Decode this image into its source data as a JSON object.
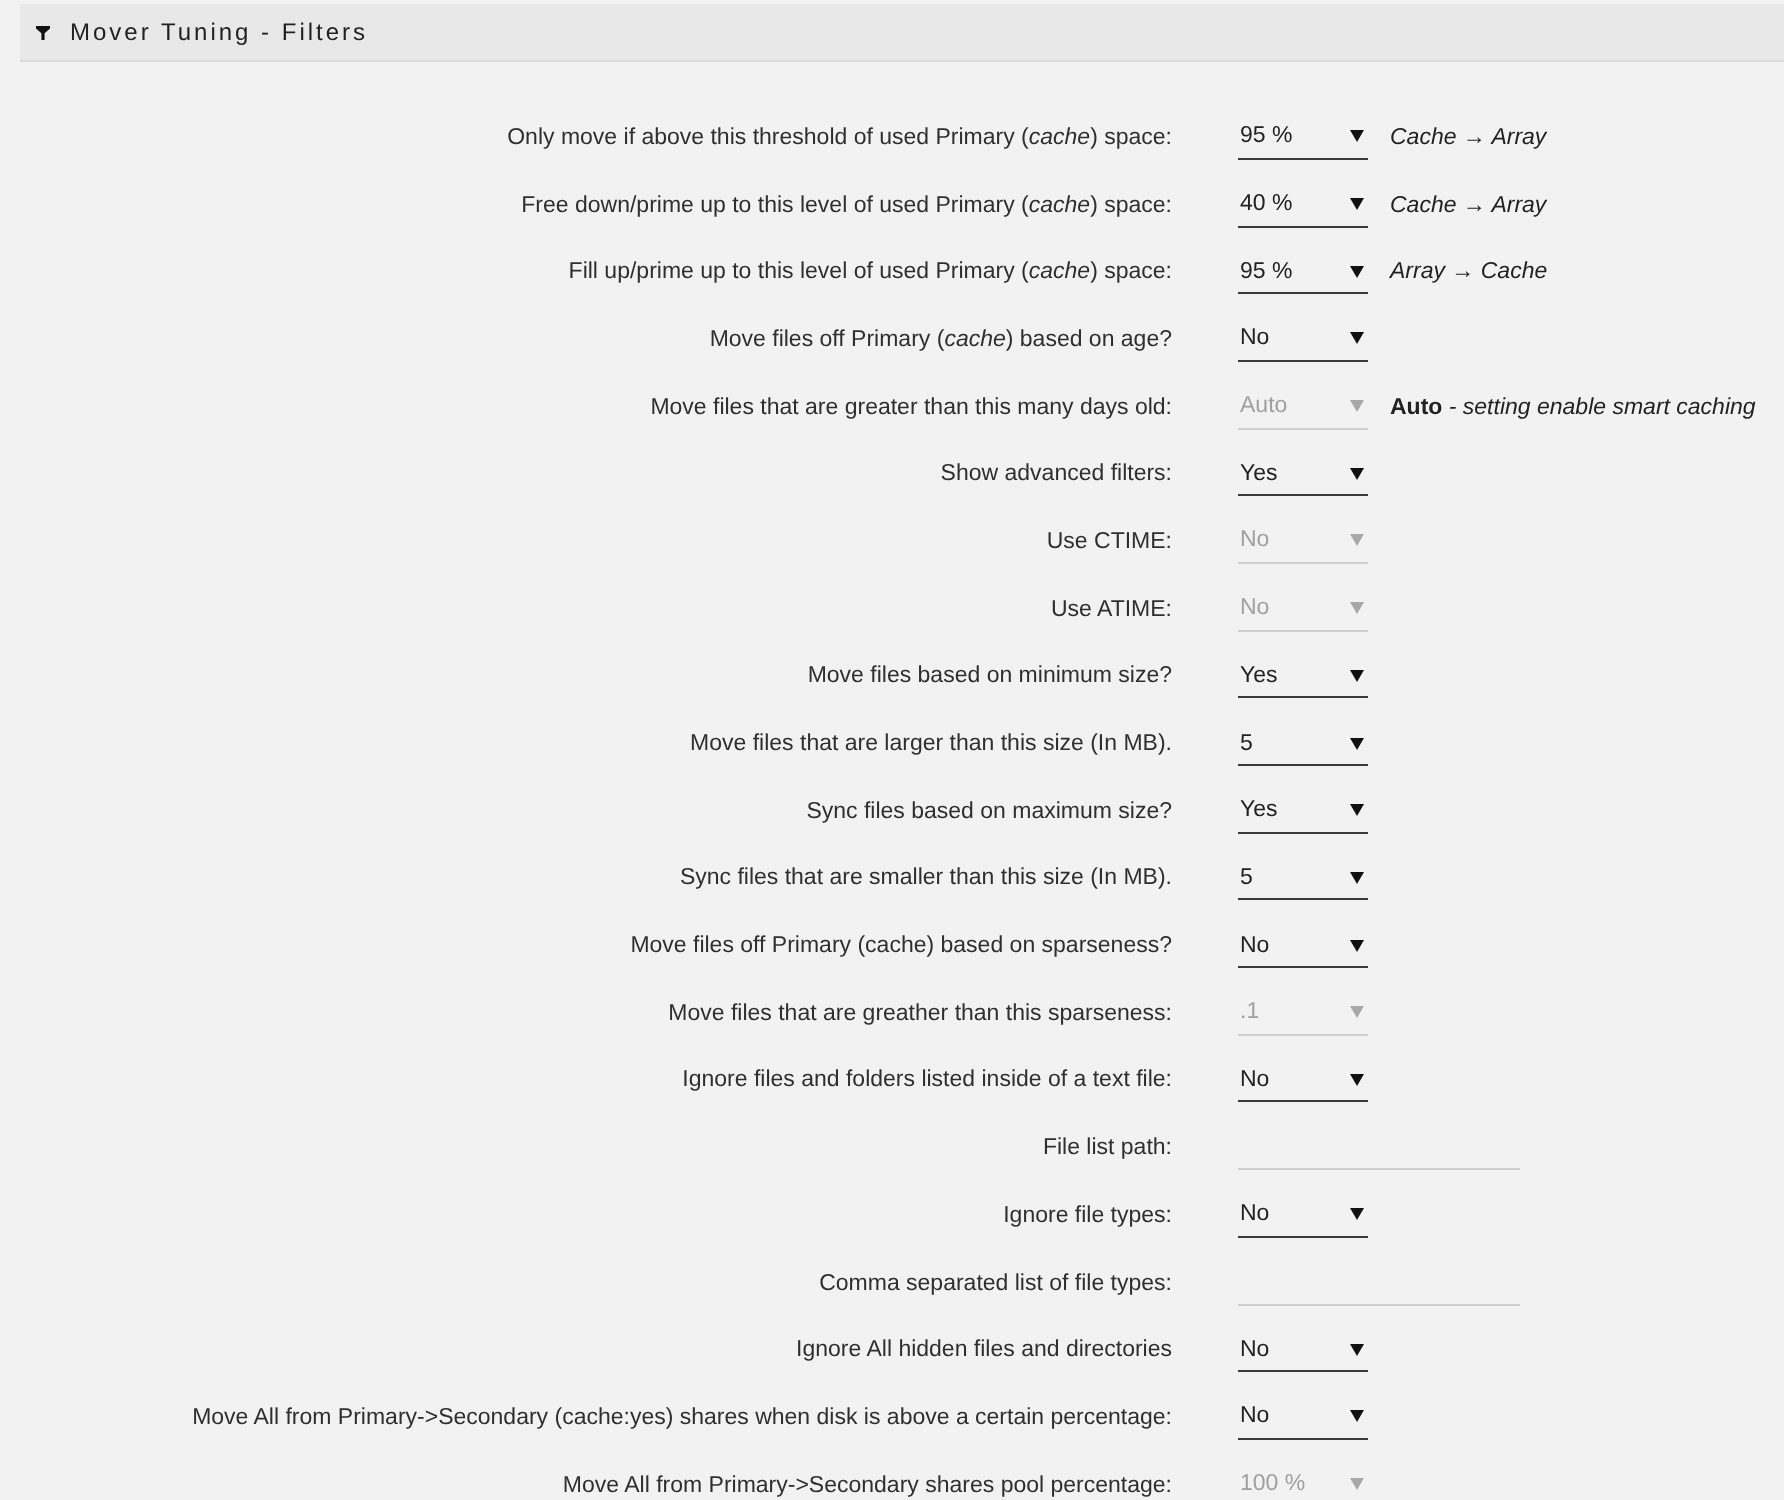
{
  "header": {
    "title": "Mover Tuning - Filters"
  },
  "settings": [
    {
      "label": "Only move if above this threshold of used Primary (*cache*) space:",
      "kind": "select",
      "value": "95 %",
      "disabled": false,
      "note": "Cache → Array"
    },
    {
      "label": "Free down/prime up to this level of used Primary (*cache*) space:",
      "kind": "select",
      "value": "40 %",
      "disabled": false,
      "note": "Cache → Array"
    },
    {
      "label": "Fill up/prime up to this level of used Primary (*cache*) space:",
      "kind": "select",
      "value": "95 %",
      "disabled": false,
      "note": "Array → Cache"
    },
    {
      "label": "Move files off Primary (*cache*) based on age?",
      "kind": "select",
      "value": "No",
      "disabled": false
    },
    {
      "label": "Move files that are greater than this many days old:",
      "kind": "select",
      "value": "Auto",
      "disabled": true,
      "note": "**Auto** - setting enable smart caching"
    },
    {
      "label": "Show advanced filters:",
      "kind": "select",
      "value": "Yes",
      "disabled": false
    },
    {
      "label": "Use CTIME:",
      "kind": "select",
      "value": "No",
      "disabled": true
    },
    {
      "label": "Use ATIME:",
      "kind": "select",
      "value": "No",
      "disabled": true
    },
    {
      "label": "Move files based on minimum size?",
      "kind": "select",
      "value": "Yes",
      "disabled": false
    },
    {
      "label": "Move files that are larger than this size (In MB).",
      "kind": "select",
      "value": "5",
      "disabled": false
    },
    {
      "label": "Sync files based on maximum size?",
      "kind": "select",
      "value": "Yes",
      "disabled": false
    },
    {
      "label": "Sync files that are smaller than this size (In MB).",
      "kind": "select",
      "value": "5",
      "disabled": false
    },
    {
      "label": "Move files off Primary (cache) based on sparseness?",
      "kind": "select",
      "value": "No",
      "disabled": false
    },
    {
      "label": "Move files that are greather than this sparseness:",
      "kind": "select",
      "value": ".1",
      "disabled": true
    },
    {
      "label": "Ignore files and folders listed inside of a text file:",
      "kind": "select",
      "value": "No",
      "disabled": false
    },
    {
      "label": "File list path:",
      "kind": "text"
    },
    {
      "label": "Ignore file types:",
      "kind": "select",
      "value": "No",
      "disabled": false
    },
    {
      "label": "Comma separated list of file types:",
      "kind": "text"
    },
    {
      "label": "Ignore All hidden files and directories",
      "kind": "select",
      "value": "No",
      "disabled": false
    },
    {
      "label": "Move All from Primary->Secondary (cache:yes) shares when disk is above a certain percentage:",
      "kind": "select",
      "value": "No",
      "disabled": false
    },
    {
      "label": "Move All from Primary->Secondary shares pool percentage:",
      "kind": "select",
      "value": "100 %",
      "disabled": true
    }
  ]
}
